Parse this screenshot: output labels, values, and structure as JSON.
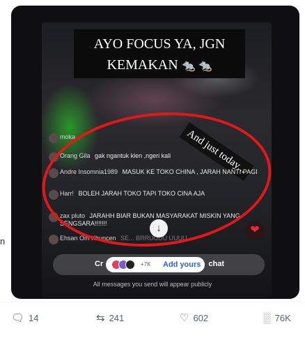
{
  "side_fragment": "n",
  "video": {
    "banner_line1": "AYO FOCUS YA, JGN",
    "banner_line2": "KEMAKAN",
    "banner_emoji": "🐀 🐀",
    "sticker": "And just today...",
    "comments": [
      {
        "user": "moka",
        "text": "",
        "faded": true
      },
      {
        "user": "Orang Gila",
        "text": "gak ngantuk klen ,ngeri kali"
      },
      {
        "user": "Andre Insomnia1989",
        "text": "MASUK KE TOKO CHINA , JARAH NANTI PAGI"
      },
      {
        "user": "Harr!",
        "text": "BOLEH JARAH TOKO TAPI TOKO CINA AJA"
      },
      {
        "user": "zax pluto",
        "text": "JARAHH BIAR BUKAN MASYARAKAT MISKIN YANG SENGSARA!!!!!!!"
      },
      {
        "user": "Ehsan Om Khuncen",
        "text": "SE... BRRUUUU UUUU",
        "faded": true
      }
    ],
    "chat_left": "Cr",
    "chat_right": "chat",
    "add_yours": {
      "count": "+7K",
      "label": "Add yours"
    },
    "footnote": "All messages you send will appear publicly",
    "colors": {
      "circle": "#e01818",
      "heart": "#e52a40",
      "accent": "#2962d9"
    }
  },
  "actions": {
    "replies": "14",
    "reposts": "241",
    "likes": "602",
    "views": "76K"
  }
}
